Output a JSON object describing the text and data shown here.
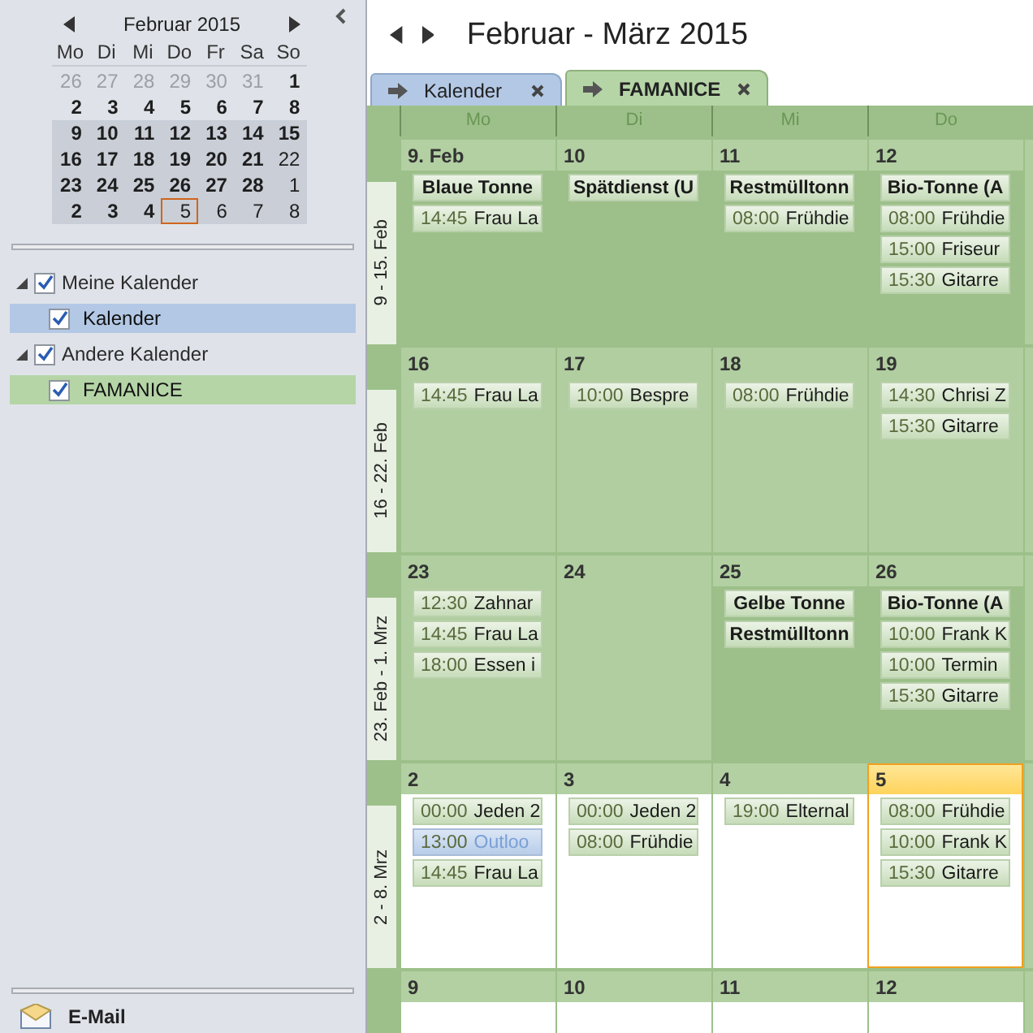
{
  "sidebar": {
    "mini_calendar": {
      "month": "Februar 2015",
      "weekdays": [
        "Mo",
        "Di",
        "Mi",
        "Do",
        "Fr",
        "Sa",
        "So"
      ],
      "weeks": [
        {
          "selected": false,
          "days": [
            {
              "label": "26",
              "outside": true,
              "busy": false,
              "today": false
            },
            {
              "label": "27",
              "outside": true,
              "busy": false,
              "today": false
            },
            {
              "label": "28",
              "outside": true,
              "busy": false,
              "today": false
            },
            {
              "label": "29",
              "outside": true,
              "busy": false,
              "today": false
            },
            {
              "label": "30",
              "outside": true,
              "busy": false,
              "today": false
            },
            {
              "label": "31",
              "outside": true,
              "busy": false,
              "today": false
            },
            {
              "label": "1",
              "outside": false,
              "busy": true,
              "today": false
            }
          ]
        },
        {
          "selected": false,
          "days": [
            {
              "label": "2",
              "outside": false,
              "busy": true,
              "today": false
            },
            {
              "label": "3",
              "outside": false,
              "busy": true,
              "today": false
            },
            {
              "label": "4",
              "outside": false,
              "busy": true,
              "today": false
            },
            {
              "label": "5",
              "outside": false,
              "busy": true,
              "today": false
            },
            {
              "label": "6",
              "outside": false,
              "busy": true,
              "today": false
            },
            {
              "label": "7",
              "outside": false,
              "busy": true,
              "today": false
            },
            {
              "label": "8",
              "outside": false,
              "busy": true,
              "today": false
            }
          ]
        },
        {
          "selected": true,
          "days": [
            {
              "label": "9",
              "outside": false,
              "busy": true,
              "today": false
            },
            {
              "label": "10",
              "outside": false,
              "busy": true,
              "today": false
            },
            {
              "label": "11",
              "outside": false,
              "busy": true,
              "today": false
            },
            {
              "label": "12",
              "outside": false,
              "busy": true,
              "today": false
            },
            {
              "label": "13",
              "outside": false,
              "busy": true,
              "today": false
            },
            {
              "label": "14",
              "outside": false,
              "busy": true,
              "today": false
            },
            {
              "label": "15",
              "outside": false,
              "busy": true,
              "today": false
            }
          ]
        },
        {
          "selected": true,
          "days": [
            {
              "label": "16",
              "outside": false,
              "busy": true,
              "today": false
            },
            {
              "label": "17",
              "outside": false,
              "busy": true,
              "today": false
            },
            {
              "label": "18",
              "outside": false,
              "busy": true,
              "today": false
            },
            {
              "label": "19",
              "outside": false,
              "busy": true,
              "today": false
            },
            {
              "label": "20",
              "outside": false,
              "busy": true,
              "today": false
            },
            {
              "label": "21",
              "outside": false,
              "busy": true,
              "today": false
            },
            {
              "label": "22",
              "outside": false,
              "busy": false,
              "today": false
            }
          ]
        },
        {
          "selected": true,
          "days": [
            {
              "label": "23",
              "outside": false,
              "busy": true,
              "today": false
            },
            {
              "label": "24",
              "outside": false,
              "busy": true,
              "today": false
            },
            {
              "label": "25",
              "outside": false,
              "busy": true,
              "today": false
            },
            {
              "label": "26",
              "outside": false,
              "busy": true,
              "today": false
            },
            {
              "label": "27",
              "outside": false,
              "busy": true,
              "today": false
            },
            {
              "label": "28",
              "outside": false,
              "busy": true,
              "today": false
            },
            {
              "label": "1",
              "outside": false,
              "busy": false,
              "today": false
            }
          ]
        },
        {
          "selected": true,
          "days": [
            {
              "label": "2",
              "outside": false,
              "busy": true,
              "today": false
            },
            {
              "label": "3",
              "outside": false,
              "busy": true,
              "today": false
            },
            {
              "label": "4",
              "outside": false,
              "busy": true,
              "today": false
            },
            {
              "label": "5",
              "outside": false,
              "busy": false,
              "today": true
            },
            {
              "label": "6",
              "outside": false,
              "busy": false,
              "today": false
            },
            {
              "label": "7",
              "outside": false,
              "busy": false,
              "today": false
            },
            {
              "label": "8",
              "outside": false,
              "busy": false,
              "today": false
            }
          ]
        }
      ]
    },
    "calendar_groups": [
      {
        "label": "Meine Kalender",
        "checked": true,
        "expanded": true,
        "children": [
          {
            "label": "Kalender",
            "checked": true,
            "color": "#b3c8e5"
          }
        ]
      },
      {
        "label": "Andere Kalender",
        "checked": true,
        "expanded": true,
        "children": [
          {
            "label": "FAMANICE",
            "checked": true,
            "color": "#b5d5a7"
          }
        ]
      }
    ],
    "nav": [
      {
        "label": "E-Mail"
      }
    ]
  },
  "header": {
    "title": "Februar - März 2015"
  },
  "tabs": [
    {
      "label": "Kalender",
      "selected": false,
      "color": "#b3c8e5"
    },
    {
      "label": "FAMANICE",
      "selected": true,
      "color": "#b5d5a7"
    }
  ],
  "weekday_headers": [
    "Mo",
    "Di",
    "Mi",
    "Do"
  ],
  "weeks": [
    {
      "label": "9 - 15. Feb",
      "days": [
        {
          "date": "9. Feb",
          "kind": "dark",
          "today": false,
          "events": [
            {
              "kind": "allday",
              "title": "Blaue Tonne",
              "selected": false
            },
            {
              "kind": "timed",
              "time": "14:45",
              "title": "Frau La",
              "selected": false
            }
          ]
        },
        {
          "date": "10",
          "kind": "dark",
          "today": false,
          "events": [
            {
              "kind": "allday",
              "title": "Spätdienst (U",
              "selected": false
            }
          ]
        },
        {
          "date": "11",
          "kind": "dark",
          "today": false,
          "events": [
            {
              "kind": "allday",
              "title": "Restmülltonn",
              "selected": false
            },
            {
              "kind": "timed",
              "time": "08:00",
              "title": "Frühdie",
              "selected": false
            }
          ]
        },
        {
          "date": "12",
          "kind": "dark",
          "today": false,
          "events": [
            {
              "kind": "allday",
              "title": "Bio-Tonne (A",
              "selected": false
            },
            {
              "kind": "timed",
              "time": "08:00",
              "title": "Frühdie",
              "selected": false
            },
            {
              "kind": "timed",
              "time": "15:00",
              "title": "Friseur",
              "selected": false
            },
            {
              "kind": "timed",
              "time": "15:30",
              "title": "Gitarre",
              "selected": false
            }
          ]
        }
      ]
    },
    {
      "label": "16 - 22. Feb",
      "days": [
        {
          "date": "16",
          "kind": "light",
          "today": false,
          "events": [
            {
              "kind": "timed",
              "time": "14:45",
              "title": "Frau La",
              "selected": false
            }
          ]
        },
        {
          "date": "17",
          "kind": "light",
          "today": false,
          "events": [
            {
              "kind": "timed",
              "time": "10:00",
              "title": "Bespre",
              "selected": false
            }
          ]
        },
        {
          "date": "18",
          "kind": "light",
          "today": false,
          "events": [
            {
              "kind": "timed",
              "time": "08:00",
              "title": "Frühdie",
              "selected": false
            }
          ]
        },
        {
          "date": "19",
          "kind": "light",
          "today": false,
          "events": [
            {
              "kind": "timed",
              "time": "14:30",
              "title": "Chrisi Z",
              "selected": false
            },
            {
              "kind": "timed",
              "time": "15:30",
              "title": "Gitarre",
              "selected": false
            }
          ]
        }
      ]
    },
    {
      "label": "23. Feb - 1. Mrz",
      "days": [
        {
          "date": "23",
          "kind": "light",
          "today": false,
          "events": [
            {
              "kind": "timed",
              "time": "12:30",
              "title": "Zahnar",
              "selected": false
            },
            {
              "kind": "timed",
              "time": "14:45",
              "title": "Frau La",
              "selected": false
            },
            {
              "kind": "timed",
              "time": "18:00",
              "title": "Essen i",
              "selected": false
            }
          ]
        },
        {
          "date": "24",
          "kind": "light",
          "today": false
        },
        {
          "date": "25",
          "kind": "dark",
          "today": false,
          "events": [
            {
              "kind": "allday",
              "title": "Gelbe Tonne",
              "selected": false
            },
            {
              "kind": "allday",
              "title": "Restmülltonn",
              "selected": false
            }
          ]
        },
        {
          "date": "26",
          "kind": "dark",
          "today": false,
          "events": [
            {
              "kind": "allday",
              "title": "Bio-Tonne (A",
              "selected": false
            },
            {
              "kind": "timed",
              "time": "10:00",
              "title": "Frank K",
              "selected": false
            },
            {
              "kind": "timed",
              "time": "10:00",
              "title": "Termin",
              "selected": false
            },
            {
              "kind": "timed",
              "time": "15:30",
              "title": "Gitarre",
              "selected": false
            }
          ]
        }
      ]
    },
    {
      "label": "2 - 8. Mrz",
      "days": [
        {
          "date": "2",
          "kind": "white",
          "today": false,
          "events": [
            {
              "kind": "timed",
              "time": "00:00",
              "title": "Jeden 2",
              "selected": false
            },
            {
              "kind": "timed",
              "time": "13:00",
              "title": "Outloo",
              "selected": true
            },
            {
              "kind": "timed",
              "time": "14:45",
              "title": "Frau La",
              "selected": false
            }
          ]
        },
        {
          "date": "3",
          "kind": "white",
          "today": false,
          "events": [
            {
              "kind": "timed",
              "time": "00:00",
              "title": "Jeden 2",
              "selected": false
            },
            {
              "kind": "timed",
              "time": "08:00",
              "title": "Frühdie",
              "selected": false
            }
          ]
        },
        {
          "date": "4",
          "kind": "white",
          "today": false,
          "events": [
            {
              "kind": "timed",
              "time": "19:00",
              "title": "Elternal",
              "selected": false
            }
          ]
        },
        {
          "date": "5",
          "kind": "white",
          "today": true,
          "events": [
            {
              "kind": "timed",
              "time": "08:00",
              "title": "Frühdie",
              "selected": false
            },
            {
              "kind": "timed",
              "time": "10:00",
              "title": "Frank K",
              "selected": false
            },
            {
              "kind": "timed",
              "time": "15:30",
              "title": "Gitarre",
              "selected": false
            }
          ]
        }
      ]
    },
    {
      "days": [
        {
          "date": "9",
          "kind": "white",
          "today": false
        },
        {
          "date": "10",
          "kind": "white",
          "today": false
        },
        {
          "date": "11",
          "kind": "white",
          "today": false
        },
        {
          "date": "12",
          "kind": "white",
          "today": false
        }
      ]
    }
  ]
}
